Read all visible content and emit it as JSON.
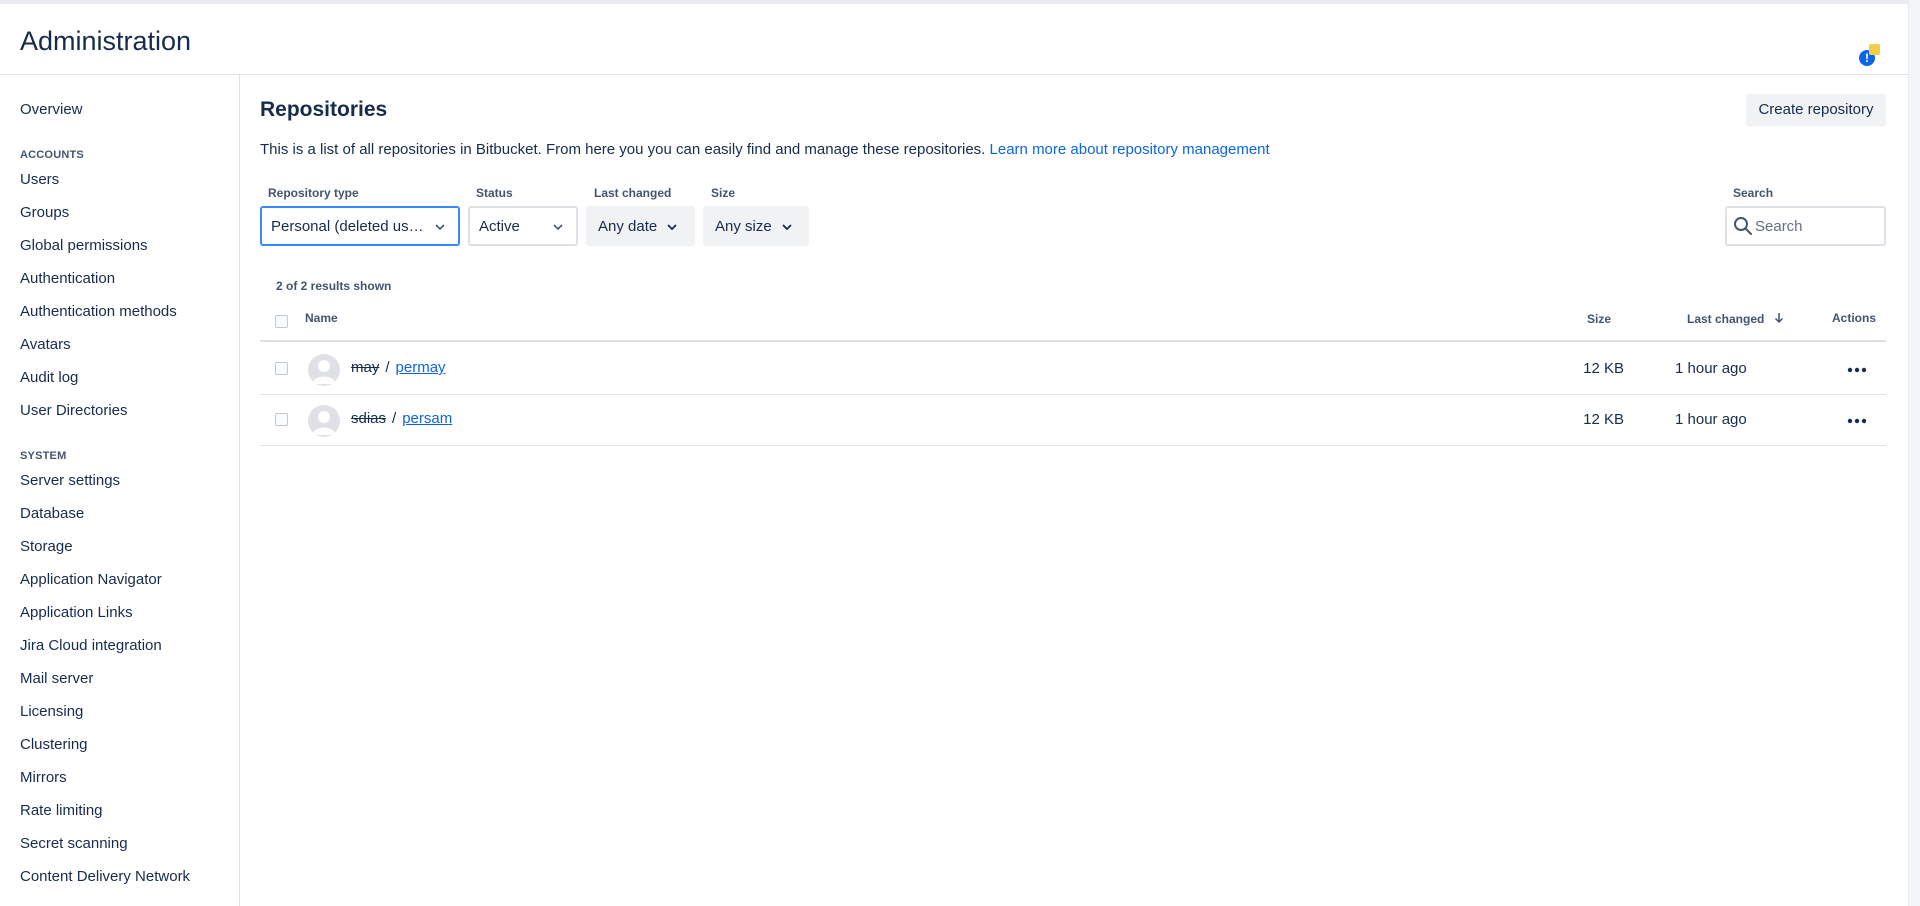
{
  "header": {
    "title": "Administration"
  },
  "sidebar": {
    "overview": "Overview",
    "accounts_heading": "ACCOUNTS",
    "accounts": [
      "Users",
      "Groups",
      "Global permissions",
      "Authentication",
      "Authentication methods",
      "Avatars",
      "Audit log",
      "User Directories"
    ],
    "system_heading": "SYSTEM",
    "system": [
      "Server settings",
      "Database",
      "Storage",
      "Application Navigator",
      "Application Links",
      "Jira Cloud integration",
      "Mail server",
      "Licensing",
      "Clustering",
      "Mirrors",
      "Rate limiting",
      "Secret scanning",
      "Content Delivery Network"
    ]
  },
  "main": {
    "title": "Repositories",
    "create_label": "Create repository",
    "description": "This is a list of all repositories in Bitbucket. From here you you can easily find and manage these repositories.",
    "learn_more": "Learn more about repository management"
  },
  "filters": {
    "repo_type_label": "Repository type",
    "repo_type_value": "Personal (deleted us…",
    "status_label": "Status",
    "status_value": "Active",
    "last_changed_label": "Last changed",
    "last_changed_value": "Any date",
    "size_label": "Size",
    "size_value": "Any size",
    "search_label": "Search",
    "search_placeholder": "Search"
  },
  "results_text": "2 of 2 results shown",
  "table": {
    "col_name": "Name",
    "col_size": "Size",
    "col_last_changed": "Last changed",
    "col_actions": "Actions",
    "rows": [
      {
        "owner": "may",
        "repo": "permay",
        "size": "12 KB",
        "changed": "1 hour ago"
      },
      {
        "owner": "sdias",
        "repo": "persam",
        "size": "12 KB",
        "changed": "1 hour ago"
      }
    ]
  },
  "notification": {
    "count": "!"
  },
  "colors": {
    "link": "#0c66e4",
    "text": "#172b4d",
    "focus": "#388bff"
  }
}
